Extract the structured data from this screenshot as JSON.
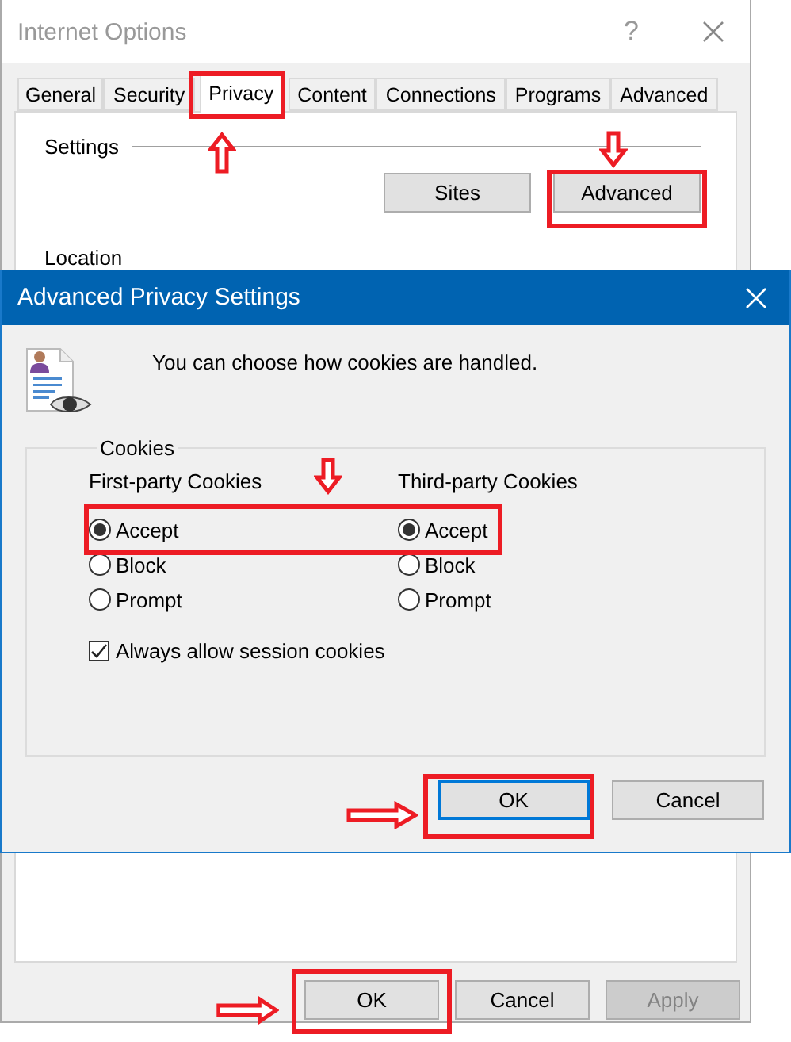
{
  "window": {
    "title": "Internet Options",
    "help": "?"
  },
  "tabs": [
    {
      "label": "General",
      "selected": false
    },
    {
      "label": "Security",
      "selected": false
    },
    {
      "label": "Privacy",
      "selected": true
    },
    {
      "label": "Content",
      "selected": false
    },
    {
      "label": "Connections",
      "selected": false
    },
    {
      "label": "Programs",
      "selected": false
    },
    {
      "label": "Advanced",
      "selected": false
    }
  ],
  "settings": {
    "heading": "Settings",
    "buttons": [
      "Sites",
      "Advanced"
    ]
  },
  "location": {
    "heading": "Location"
  },
  "dialog": {
    "title": "Advanced Privacy Settings",
    "description": "You can choose how cookies are handled.",
    "group": "Cookies",
    "columns": [
      {
        "heading": "First-party Cookies",
        "options": [
          {
            "label": "Accept",
            "selected": true
          },
          {
            "label": "Block",
            "selected": false
          },
          {
            "label": "Prompt",
            "selected": false
          }
        ]
      },
      {
        "heading": "Third-party Cookies",
        "options": [
          {
            "label": "Accept",
            "selected": true
          },
          {
            "label": "Block",
            "selected": false
          },
          {
            "label": "Prompt",
            "selected": false
          }
        ]
      }
    ],
    "session": {
      "label": "Always allow session cookies",
      "checked": true
    },
    "buttons": [
      {
        "label": "OK",
        "default": true
      },
      {
        "label": "Cancel",
        "default": false
      }
    ]
  },
  "buttons": [
    {
      "label": "OK",
      "disabled": false
    },
    {
      "label": "Cancel",
      "disabled": false
    },
    {
      "label": "Apply",
      "disabled": true
    }
  ]
}
